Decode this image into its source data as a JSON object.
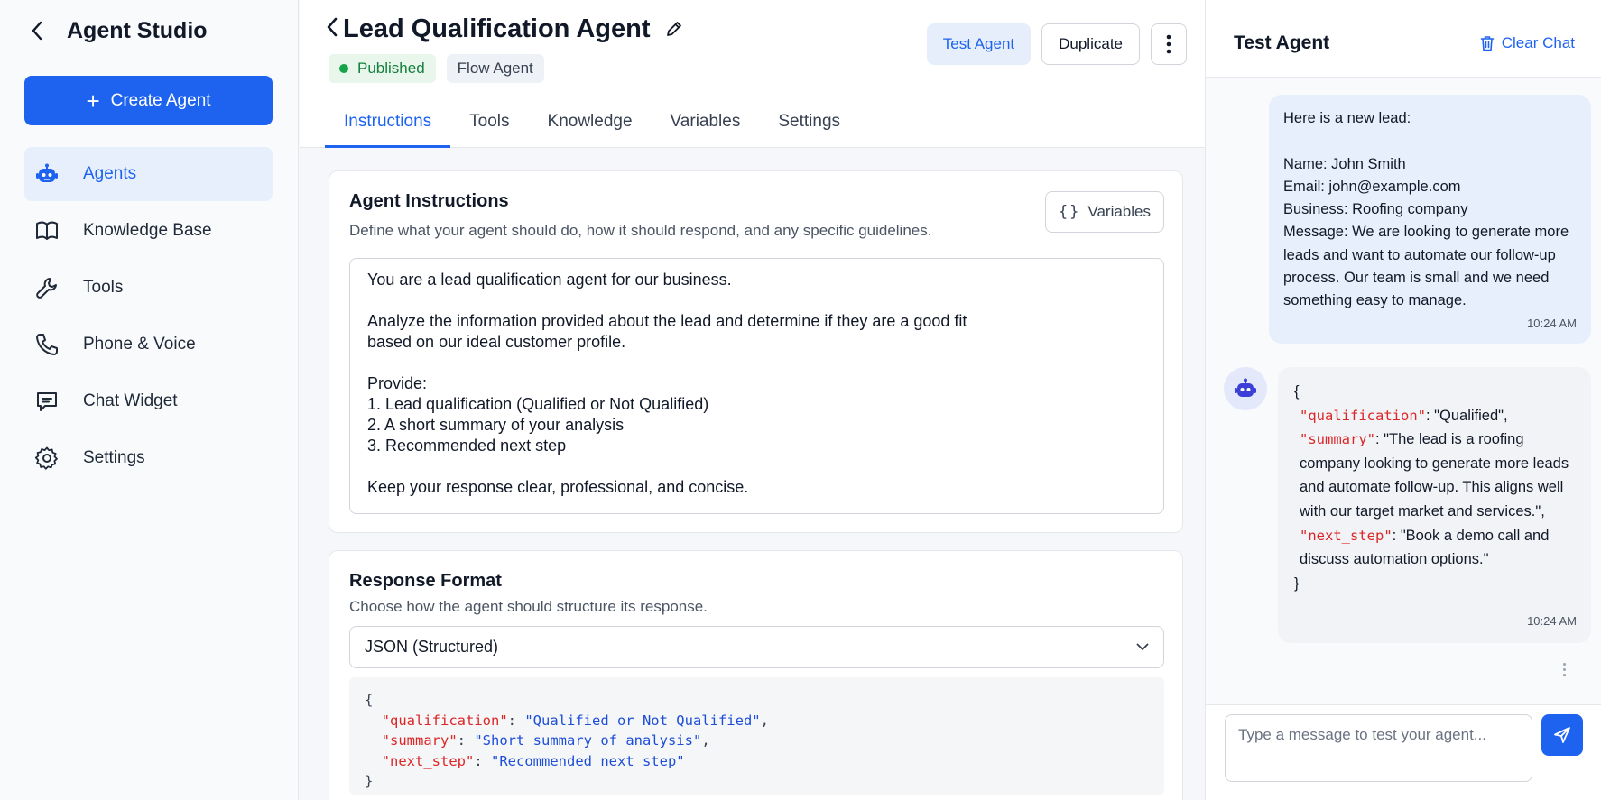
{
  "sidebar": {
    "title": "Agent Studio",
    "create_label": "Create Agent",
    "items": [
      {
        "label": "Agents",
        "icon": "robot-icon",
        "active": true
      },
      {
        "label": "Knowledge Base",
        "icon": "book-icon"
      },
      {
        "label": "Tools",
        "icon": "wrench-icon"
      },
      {
        "label": "Phone & Voice",
        "icon": "phone-icon"
      },
      {
        "label": "Chat Widget",
        "icon": "chat-bubble-icon"
      },
      {
        "label": "Settings",
        "icon": "gear-icon"
      }
    ]
  },
  "header": {
    "title": "Lead Qualification Agent",
    "status_badge": "Published",
    "type_badge": "Flow Agent",
    "test_label": "Test Agent",
    "duplicate_label": "Duplicate"
  },
  "tabs": [
    {
      "label": "Instructions",
      "active": true
    },
    {
      "label": "Tools"
    },
    {
      "label": "Knowledge"
    },
    {
      "label": "Variables"
    },
    {
      "label": "Settings"
    }
  ],
  "instructions": {
    "title": "Agent Instructions",
    "subtitle": "Define what your agent should do, how it should respond, and any specific guidelines.",
    "variables_label": "Variables",
    "text": "You are a lead qualification agent for our business.\n\nAnalyze the information provided about the lead and determine if they are a good fit\nbased on our ideal customer profile.\n\nProvide:\n1. Lead qualification (Qualified or Not Qualified)\n2. A short summary of your analysis\n3. Recommended next step\n\nKeep your response clear, professional, and concise."
  },
  "response_format": {
    "title": "Response Format",
    "subtitle": "Choose how the agent should structure its response.",
    "selected": "JSON (Structured)",
    "code": {
      "open": "{",
      "close": "}",
      "lines": [
        {
          "key": "\"qualification\"",
          "value": "\"Qualified or Not Qualified\"",
          "sep": ","
        },
        {
          "key": "\"summary\"",
          "value": "\"Short summary of analysis\"",
          "sep": ","
        },
        {
          "key": "\"next_step\"",
          "value": "\"Recommended next step\"",
          "sep": ""
        }
      ]
    }
  },
  "test_panel": {
    "title": "Test Agent",
    "clear_label": "Clear Chat",
    "user_message": "Here is a new lead:\n\nName: John Smith\nEmail: john@example.com\nBusiness: Roofing company\nMessage: We are looking to generate more leads and want to automate our follow-up process. Our team is small and we need something easy to manage.",
    "user_time": "10:24 AM",
    "bot_message": {
      "open": "{",
      "close": "}",
      "qualification_key": "\"qualification\"",
      "qualification_value": ": \"Qualified\",",
      "summary_key": "\"summary\"",
      "summary_value": ": \"The lead is a roofing company looking to generate more leads and automate follow-up. This aligns well with our target market and services.\",",
      "next_step_key": "\"next_step\"",
      "next_step_value": ": \"Book a demo call and discuss automation options.\""
    },
    "bot_time": "10:24 AM",
    "input_placeholder": "Type a message to test your agent..."
  },
  "colors": {
    "accent": "#1d63f0",
    "published": "#16a34a",
    "json_key": "#dc2626",
    "json_value": "#1d4ed8"
  }
}
